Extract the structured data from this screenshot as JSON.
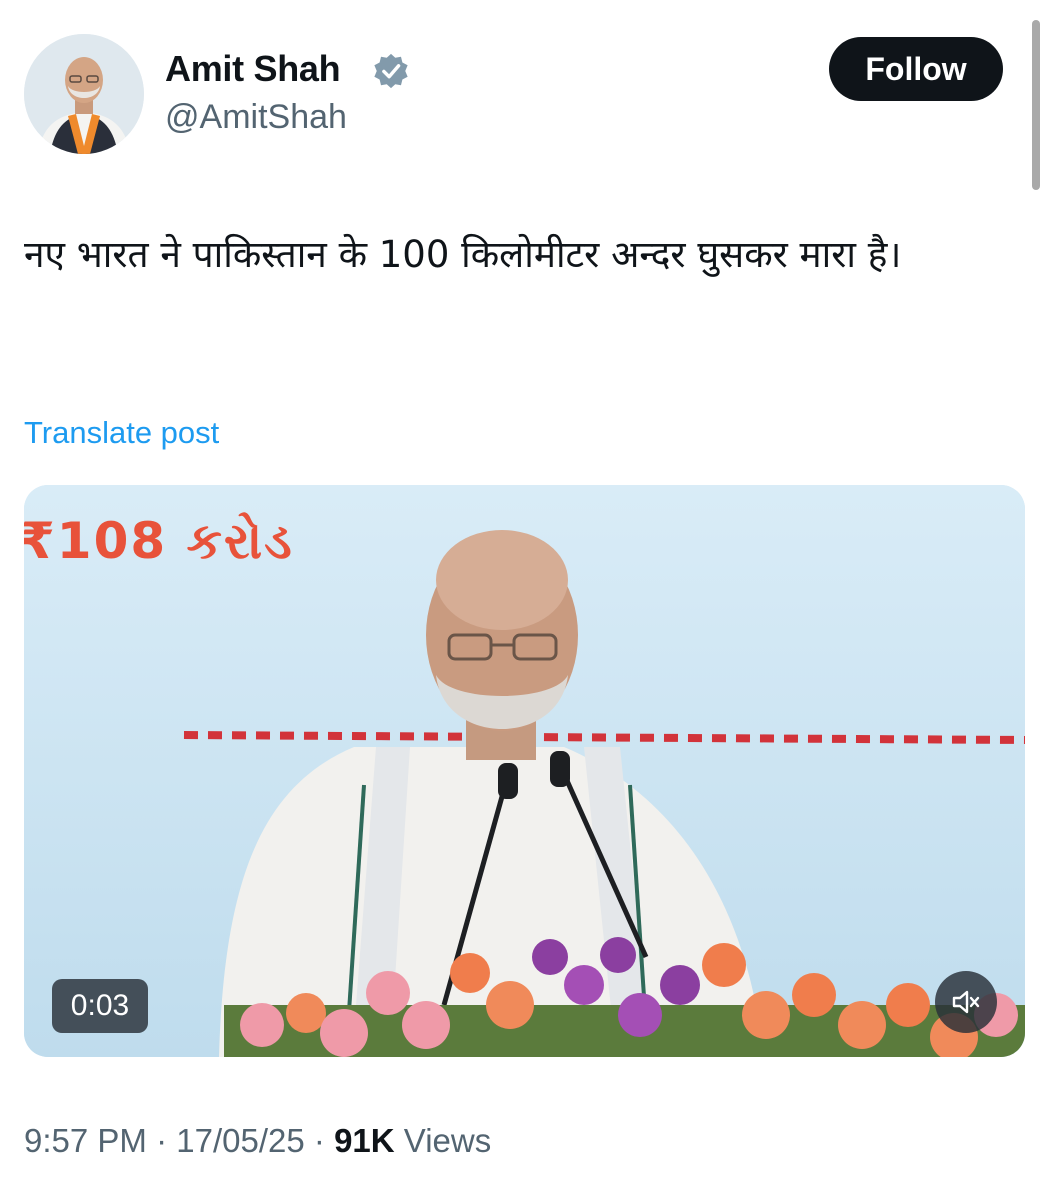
{
  "author": {
    "name": "Amit Shah",
    "handle": "@AmitShah",
    "verified_icon": "verified-badge-icon",
    "avatar_icon": "profile-photo"
  },
  "follow_label": "Follow",
  "post": {
    "text": "नए भारत ने पाकिस्तान के 100 किलोमीटर अन्दर घुसकर मारा है।",
    "translate_label": "Translate post"
  },
  "media": {
    "banner_text": "₹108 કરોડ",
    "duration": "0:03",
    "mute_icon": "speaker-muted-icon"
  },
  "meta": {
    "time": "9:57 PM",
    "separator": "·",
    "date": "17/05/25",
    "views_count": "91K",
    "views_label": "Views"
  },
  "colors": {
    "text": "#0f1419",
    "secondary": "#536471",
    "link": "#1d9bf0",
    "button_bg": "#0f1419",
    "media_bg": "#cde5f2",
    "banner": "#e8523a"
  }
}
